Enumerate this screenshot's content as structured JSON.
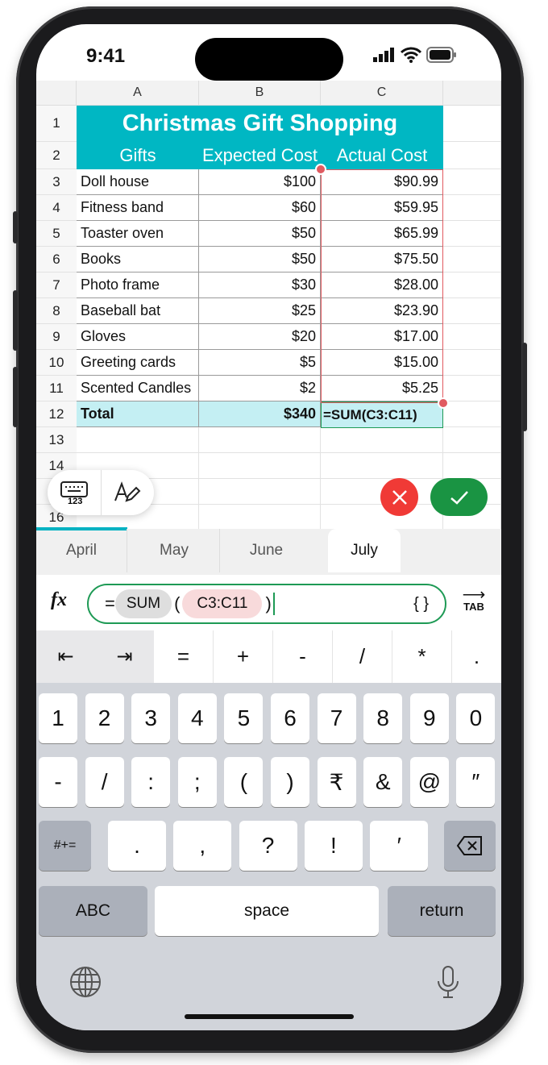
{
  "status": {
    "time": "9:41"
  },
  "columns": [
    "A",
    "B",
    "C"
  ],
  "rows": [
    "1",
    "2",
    "3",
    "4",
    "5",
    "6",
    "7",
    "8",
    "9",
    "10",
    "11",
    "12",
    "13",
    "14",
    "15",
    "16"
  ],
  "sheet": {
    "title": "Christmas Gift Shopping",
    "headers": [
      "Gifts",
      "Expected Cost",
      "Actual Cost"
    ],
    "items": [
      [
        "Doll house",
        "$100",
        "$90.99"
      ],
      [
        "Fitness band",
        "$60",
        "$59.95"
      ],
      [
        "Toaster oven",
        "$50",
        "$65.99"
      ],
      [
        "Books",
        "$50",
        "$75.50"
      ],
      [
        "Photo frame",
        "$30",
        "$28.00"
      ],
      [
        "Baseball bat",
        "$25",
        "$23.90"
      ],
      [
        "Gloves",
        "$20",
        "$17.00"
      ],
      [
        "Greeting cards",
        "$5",
        "$15.00"
      ],
      [
        "Scented Candles",
        "$2",
        "$5.25"
      ]
    ],
    "total": {
      "label": "Total",
      "expected": "$340",
      "actual": "=SUM(C3:C11)"
    },
    "colors": {
      "header": "#00b7c3",
      "total": "#c4eff3",
      "selection": "#e05a60",
      "active": "#1e9a55"
    }
  },
  "tabs": [
    "April",
    "May",
    "June",
    "July"
  ],
  "active_tab": "July",
  "formula": {
    "fx": "fx",
    "equals": "=",
    "func": "SUM",
    "open": "(",
    "range": "C3:C11",
    "close": ")",
    "braces": "{ }",
    "tab": "TAB"
  },
  "toolbar": [
    "=",
    "+",
    "-",
    "/",
    "*",
    "."
  ],
  "keyboard": {
    "row1": [
      "1",
      "2",
      "3",
      "4",
      "5",
      "6",
      "7",
      "8",
      "9",
      "0"
    ],
    "row2": [
      "-",
      "/",
      ":",
      ";",
      "(",
      ")",
      "₹",
      "&",
      "@",
      "″"
    ],
    "row3": [
      ".",
      ",",
      "?",
      "!",
      "′"
    ],
    "symbols": "#+=",
    "abc": "ABC",
    "space": "space",
    "return": "return"
  }
}
